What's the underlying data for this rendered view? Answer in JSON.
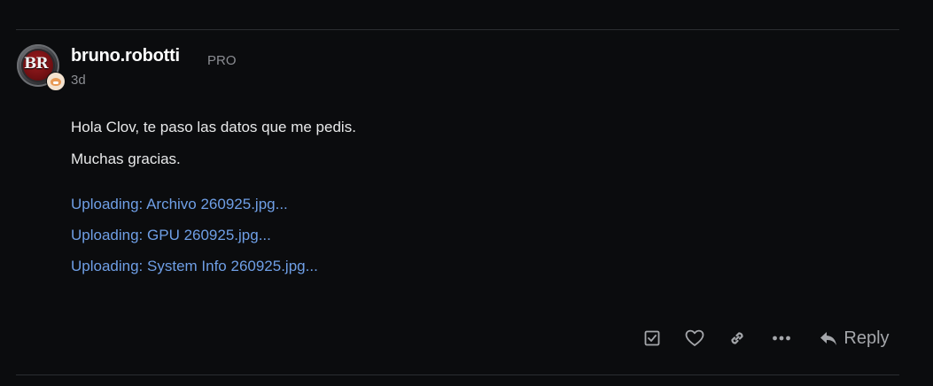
{
  "post": {
    "username": "bruno.robotti",
    "user_title": "PRO",
    "date": "3d",
    "avatar_text": "BR",
    "paragraphs": [
      "Hola Clov, te paso las datos que me pedis.",
      "Muchas gracias."
    ],
    "uploads": [
      "Uploading: Archivo 260925.jpg...",
      "Uploading: GPU 260925.jpg...",
      "Uploading: System Info 260925.jpg..."
    ]
  },
  "actions": {
    "reply_label": "Reply",
    "icons": [
      "bookmark-icon",
      "heart-icon",
      "link-icon",
      "more-icon",
      "reply-icon"
    ]
  },
  "colors": {
    "background": "#0b0c0e",
    "text": "#e8e9ea",
    "muted": "#8b8d92",
    "link": "#6f9fe6",
    "divider": "#2b2d31"
  }
}
